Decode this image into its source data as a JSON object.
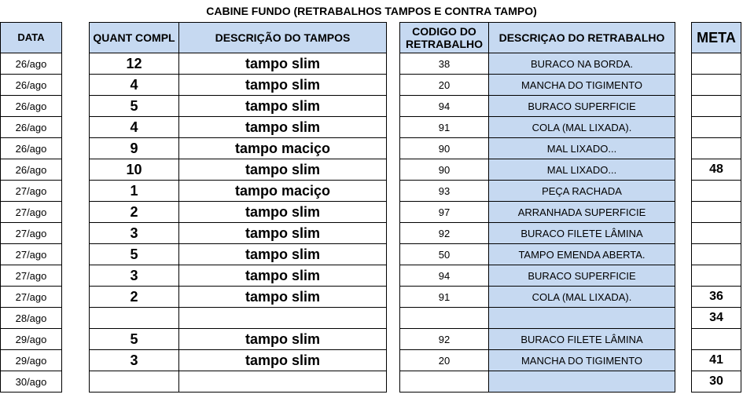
{
  "title": "CABINE FUNDO (RETRABALHOS TAMPOS E CONTRA TAMPO)",
  "header": {
    "date": "DATA",
    "qty": "QUANT COMPL",
    "desc": "DESCRIÇÃO DO TAMPOS",
    "code": "CODIGO DO RETRABALHO",
    "rework": "DESCRIÇAO DO RETRABALHO",
    "meta": "META"
  },
  "rows": [
    {
      "date": "26/ago",
      "qty": "12",
      "desc": "tampo slim",
      "code": "38",
      "rework": "BURACO NA BORDA.",
      "meta": ""
    },
    {
      "date": "26/ago",
      "qty": "4",
      "desc": "tampo slim",
      "code": "20",
      "rework": "MANCHA DO TIGIMENTO",
      "meta": ""
    },
    {
      "date": "26/ago",
      "qty": "5",
      "desc": "tampo slim",
      "code": "94",
      "rework": "BURACO SUPERFICIE",
      "meta": ""
    },
    {
      "date": "26/ago",
      "qty": "4",
      "desc": "tampo slim",
      "code": "91",
      "rework": "COLA (MAL LIXADA).",
      "meta": ""
    },
    {
      "date": "26/ago",
      "qty": "9",
      "desc": "tampo maciço",
      "code": "90",
      "rework": "MAL LIXADO...",
      "meta": ""
    },
    {
      "date": "26/ago",
      "qty": "10",
      "desc": "tampo slim",
      "code": "90",
      "rework": "MAL LIXADO...",
      "meta": "48"
    },
    {
      "date": "27/ago",
      "qty": "1",
      "desc": "tampo maciço",
      "code": "93",
      "rework": "PEÇA RACHADA",
      "meta": ""
    },
    {
      "date": "27/ago",
      "qty": "2",
      "desc": "tampo slim",
      "code": "97",
      "rework": "ARRANHADA SUPERFICIE",
      "meta": ""
    },
    {
      "date": "27/ago",
      "qty": "3",
      "desc": "tampo slim",
      "code": "92",
      "rework": "BURACO FILETE LÂMINA",
      "meta": ""
    },
    {
      "date": "27/ago",
      "qty": "5",
      "desc": "tampo slim",
      "code": "50",
      "rework": "TAMPO EMENDA ABERTA.",
      "meta": ""
    },
    {
      "date": "27/ago",
      "qty": "3",
      "desc": "tampo slim",
      "code": "94",
      "rework": "BURACO SUPERFICIE",
      "meta": ""
    },
    {
      "date": "27/ago",
      "qty": "2",
      "desc": "tampo slim",
      "code": "91",
      "rework": "COLA (MAL LIXADA).",
      "meta": "36"
    },
    {
      "date": "28/ago",
      "qty": "",
      "desc": "",
      "code": "",
      "rework": "",
      "meta": "34"
    },
    {
      "date": "29/ago",
      "qty": "5",
      "desc": "tampo slim",
      "code": "92",
      "rework": "BURACO FILETE LÂMINA",
      "meta": ""
    },
    {
      "date": "29/ago",
      "qty": "3",
      "desc": "tampo slim",
      "code": "20",
      "rework": "MANCHA DO TIGIMENTO",
      "meta": "41"
    },
    {
      "date": "30/ago",
      "qty": "",
      "desc": "",
      "code": "",
      "rework": "",
      "meta": "30"
    }
  ],
  "colors": {
    "header_fill": "#c6d9f1",
    "rework_fill": "#c6d9f1",
    "border": "#000000"
  }
}
